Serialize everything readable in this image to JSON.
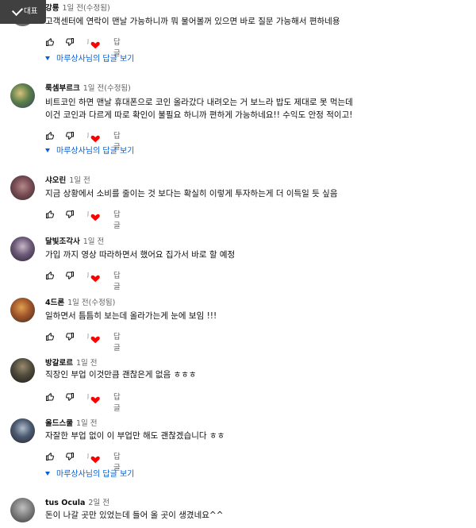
{
  "toast": {
    "label": "대표"
  },
  "actions": {
    "reply_label": "답글",
    "heart_creator_initial": "J"
  },
  "colors": {
    "link_blue": "#065fd4",
    "heart_red": "#ff0000",
    "meta_gray": "#606060"
  },
  "comments": [
    {
      "author": "강룡",
      "time": "1일 전(수정됨)",
      "lines": [
        "고객센터에 연락이 맨날 가능하니까 뭐 물어볼꺼 있으면 바로 질문 가능해서 편하네용"
      ],
      "replies_label": "마루상사님의 답글 보기"
    },
    {
      "author": "룩셈부르크",
      "time": "1일 전(수정됨)",
      "lines": [
        "비트코인 하면 맨날 휴대폰으로 코인 올라갔다 내려오는 거 보느라 밥도 제대로 못 먹는데",
        "이건 코인과 다르게 따로 확인이 불필요 하니까 편하게 가능하네요!! 수익도 안정 적이고!"
      ],
      "replies_label": "마루상사님의 답글 보기"
    },
    {
      "author": "샤오린",
      "time": "1일 전",
      "lines": [
        "지금 상황에서 소비를 줄이는 것 보다는 확실히 이렇게 투자하는게 더 이득일 듯 싶음"
      ]
    },
    {
      "author": "달빛조각사",
      "time": "1일 전",
      "lines": [
        "가입 까지 영상 따라하면서 했어요 집가서 바로 할 예정"
      ]
    },
    {
      "author": "4드론",
      "time": "1일 전(수정됨)",
      "lines": [
        "일하면서 틈틈히 보는데 올라가는게 눈에 보임 !!!"
      ]
    },
    {
      "author": "방갈로르",
      "time": "1일 전",
      "lines": [
        "직장인 부업 이것만큼 괜찮은게 없음 ㅎㅎㅎ"
      ]
    },
    {
      "author": "올드스쿨",
      "time": "1일 전",
      "lines": [
        "자잘한 부업 없이 이 부업만 해도 괜찮겠습니다 ㅎㅎ"
      ],
      "replies_label": "마루상사님의 답글 보기"
    },
    {
      "author": "tus Ocula",
      "time": "2일 전",
      "lines": [
        "돈이 나갈 곳만 있었는데 들어 올 곳이 생겼네요^^"
      ]
    }
  ]
}
